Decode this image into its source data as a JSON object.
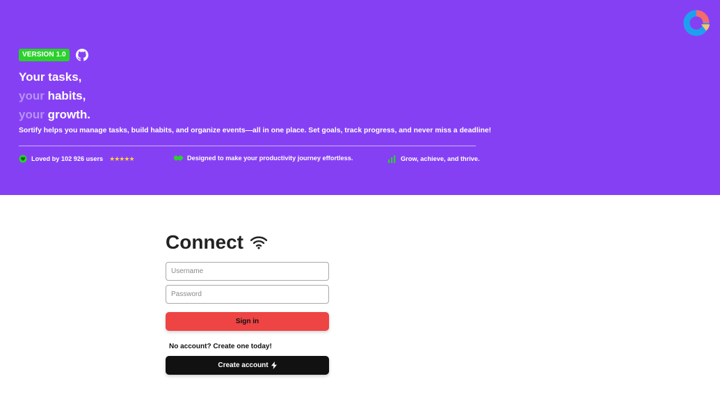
{
  "hero": {
    "version_badge": "VERSION 1.0",
    "headline": {
      "line1": "Your tasks,",
      "line2_prefix": "your",
      "line2_word": "habits,",
      "line3_prefix": "your",
      "line3_word": "growth."
    },
    "tagline": "Sortify helps you manage tasks, build habits, and organize events—all in one place. Set goals, track progress, and never miss a deadline!",
    "features": [
      {
        "icon": "heart-icon",
        "text": "Loved by 102 926 users",
        "stars": "★★★★★"
      },
      {
        "icon": "handshake-icon",
        "text": "Designed to make your productivity journey effortless."
      },
      {
        "icon": "bar-chart-icon",
        "text": "Grow, achieve, and thrive."
      }
    ]
  },
  "connect": {
    "title": "Connect",
    "username_placeholder": "Username",
    "password_placeholder": "Password",
    "signin_label": "Sign in",
    "no_account_text": "No account? Create one today!",
    "create_label": "Create account"
  },
  "colors": {
    "hero_bg": "#8640f4",
    "badge": "#2bd12b",
    "signin": "#ee4444",
    "create": "#111111"
  }
}
